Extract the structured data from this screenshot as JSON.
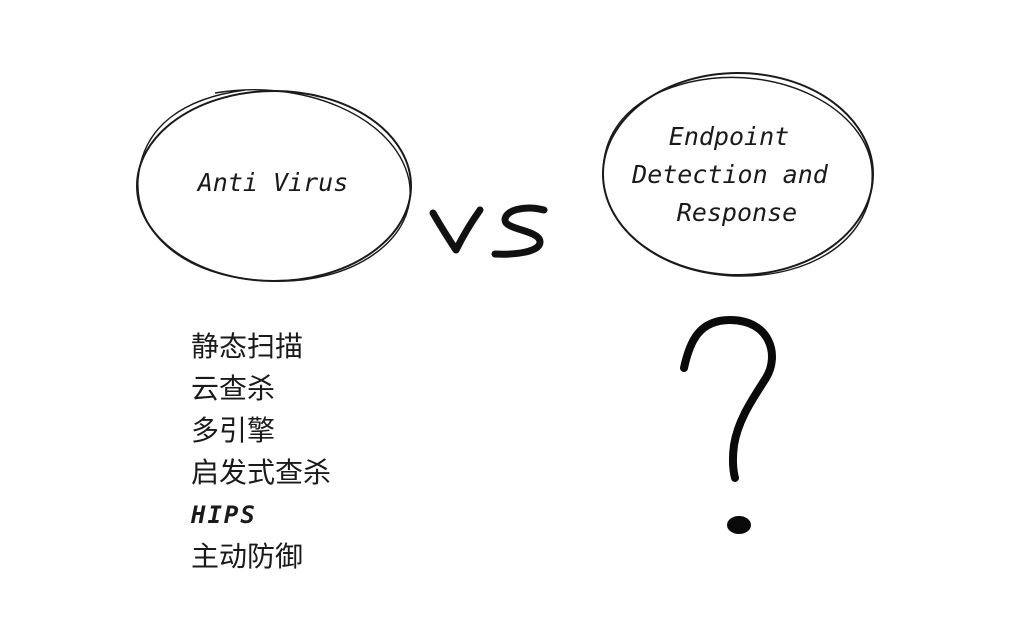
{
  "left_node": {
    "label": "Anti Virus"
  },
  "vs_label": "VS",
  "right_node": {
    "label_lines": [
      "Endpoint",
      "Detection and",
      "Response"
    ]
  },
  "question_mark": "?",
  "av_features": [
    "静态扫描",
    "云查杀",
    "多引擎",
    "启发式查杀",
    "HIPS",
    "主动防御"
  ]
}
